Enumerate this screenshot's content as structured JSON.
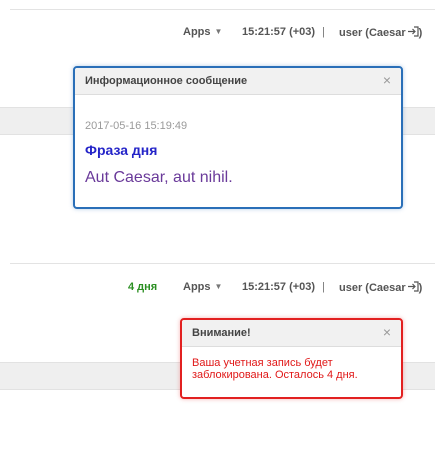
{
  "header1": {
    "apps_label": "Apps",
    "time": "15:21:57 (+03)",
    "separator": "|",
    "user_label": "user (Caesar"
  },
  "dialog1": {
    "title": "Информационное сообщение",
    "close_glyph": "×",
    "date": "2017-05-16 15:19:49",
    "heading": "Фраза дня",
    "quote": "Aut Caesar, aut nihil."
  },
  "header2": {
    "days_left": "4 дня",
    "apps_label": "Apps",
    "time": "15:21:57 (+03)",
    "separator": "|",
    "user_label": "user (Caesar"
  },
  "dialog2": {
    "title": "Внимание!",
    "close_glyph": "×",
    "message": "Ваша учетная запись будет заблокирована. Осталось 4 дня."
  },
  "colors": {
    "dialog1_border": "#2a6fb8",
    "dialog2_border": "#e22020",
    "phrase_color": "#2424c8",
    "quote_color": "#6a3a9a",
    "days_color": "#2b8f22"
  },
  "icons": [
    "caret-down-icon",
    "logout-icon",
    "close-icon"
  ]
}
